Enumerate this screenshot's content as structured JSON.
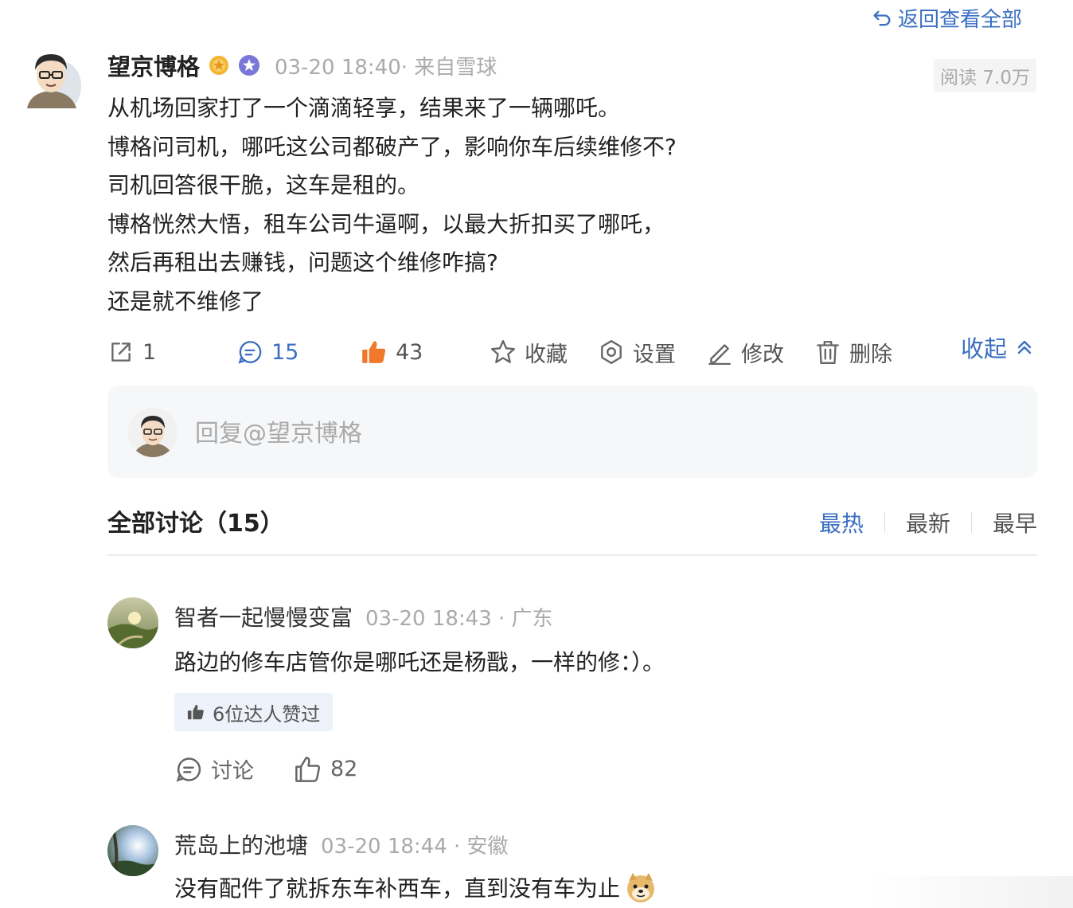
{
  "nav": {
    "back_label": "返回查看全部"
  },
  "post": {
    "author": "望京博格",
    "badge_gold": "gold-star-badge",
    "badge_purple": "purple-star-badge",
    "meta": "03-20 18:40· 来自雪球",
    "read_count": "阅读 7.0万",
    "lines": [
      "从机场回家打了一个滴滴轻享，结果来了一辆哪吒。",
      "博格问司机，哪吒这公司都破产了，影响你车后续维修不?",
      "司机回答很干脆，这车是租的。",
      "博格恍然大悟，租车公司牛逼啊，以最大折扣买了哪吒，",
      "然后再租出去赚钱，问题这个维修咋搞?",
      "还是就不维修了"
    ],
    "actions": {
      "share_count": "1",
      "comment_count": "15",
      "like_count": "43",
      "favorite_label": "收藏",
      "settings_label": "设置",
      "edit_label": "修改",
      "delete_label": "删除",
      "collapse_label": "收起"
    }
  },
  "reply": {
    "placeholder": "回复@望京博格"
  },
  "discussion": {
    "title": "全部讨论（15）",
    "tabs": [
      "最热",
      "最新",
      "最早"
    ],
    "active_tab": "最热"
  },
  "comments": [
    {
      "name": "智者一起慢慢变富",
      "meta": "03-20 18:43 · 广东",
      "text": "路边的修车店管你是哪吒还是杨戬，一样的修：）。",
      "likers": "6位达人赞过",
      "discuss_label": "讨论",
      "like_count": "82"
    },
    {
      "name": "荒岛上的池塘",
      "meta": "03-20 18:44 · 安徽",
      "text": "没有配件了就拆东车补西车，直到没有车为止",
      "emoji": "doge-emoji"
    }
  ],
  "colors": {
    "accent": "#3b6fc2",
    "like_orange": "#f0782a",
    "muted": "#aaaaaa"
  }
}
